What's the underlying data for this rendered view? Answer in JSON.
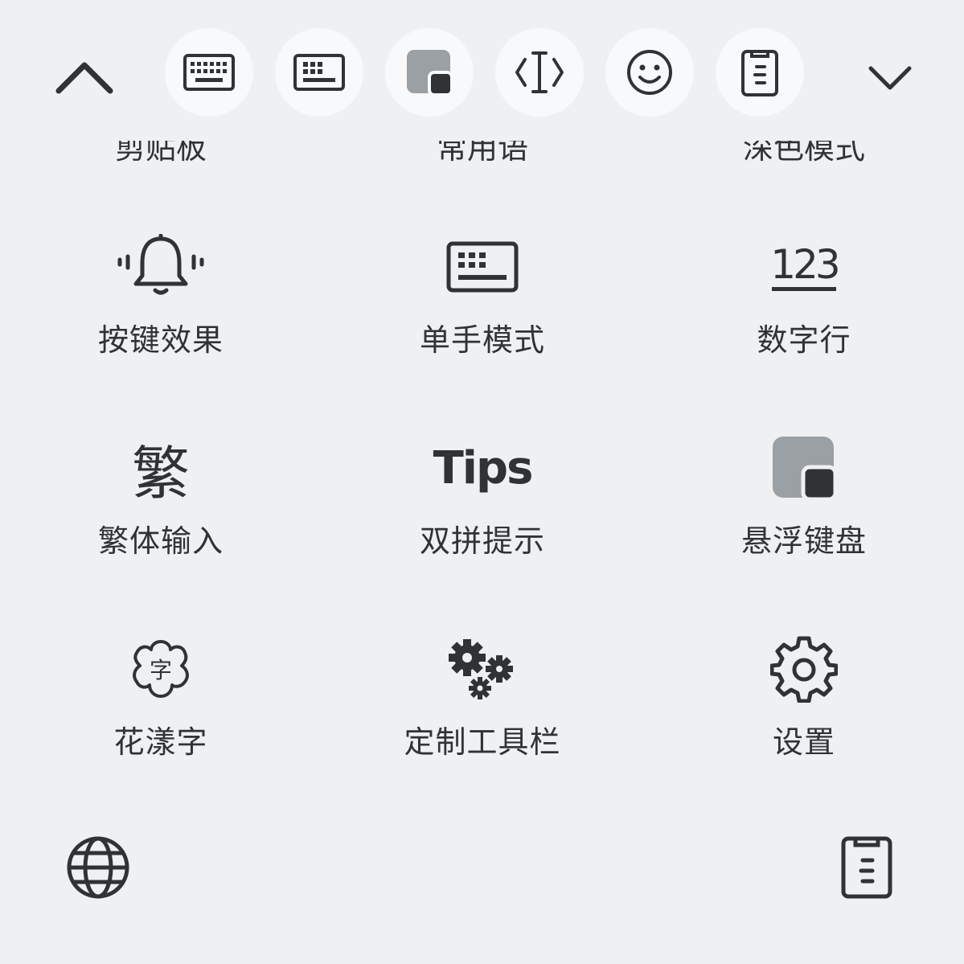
{
  "toolbar": {
    "buttons": [
      {
        "icon": "keyboard-icon"
      },
      {
        "icon": "keyboard-compact-icon"
      },
      {
        "icon": "floating-keyboard-icon"
      },
      {
        "icon": "text-cursor-icon"
      },
      {
        "icon": "emoji-icon"
      },
      {
        "icon": "clipboard-icon"
      }
    ],
    "collapse_icon": "chevron-up-icon",
    "expand_icon": "chevron-down-icon"
  },
  "clipped_row": [
    "剪贴板",
    "常用语",
    "深色模式"
  ],
  "grid": [
    {
      "label": "按键效果",
      "icon": "bell-vibrate-icon"
    },
    {
      "label": "单手模式",
      "icon": "keyboard-icon"
    },
    {
      "label": "数字行",
      "icon": "number-row-icon",
      "icon_text": "123"
    },
    {
      "label": "繁体输入",
      "icon": "traditional-chinese-icon",
      "icon_text": "繁"
    },
    {
      "label": "双拼提示",
      "icon": "tips-icon",
      "icon_text": "Tips"
    },
    {
      "label": "悬浮键盘",
      "icon": "floating-keyboard-icon"
    },
    {
      "label": "花漾字",
      "icon": "flower-char-icon",
      "icon_text": "字"
    },
    {
      "label": "定制工具栏",
      "icon": "gears-icon"
    },
    {
      "label": "设置",
      "icon": "gear-icon"
    }
  ],
  "bottom": {
    "left_icon": "globe-icon",
    "right_icon": "clipboard-icon"
  },
  "colors": {
    "background": "#eef0f2",
    "button_bg": "#f8f9fa",
    "icon": "#2f3336",
    "icon_muted": "#9aa0a3"
  }
}
